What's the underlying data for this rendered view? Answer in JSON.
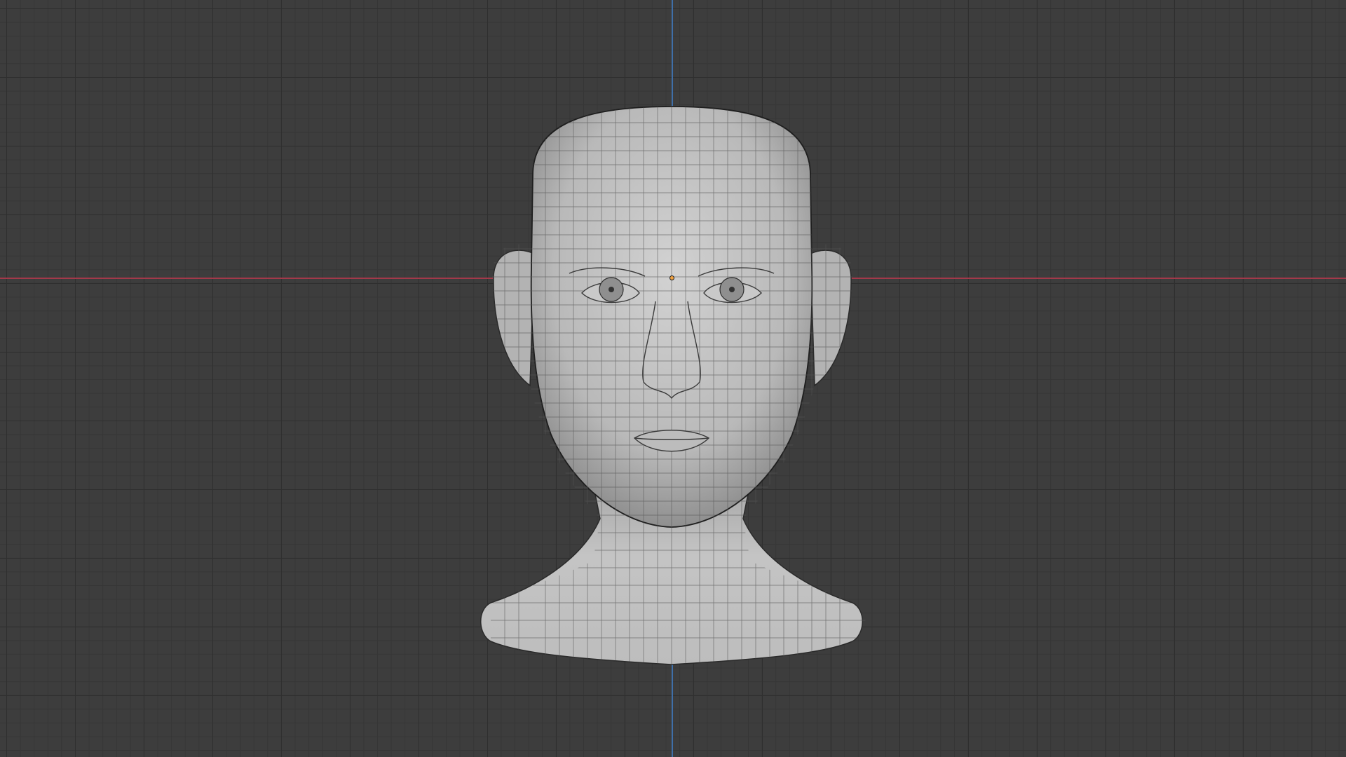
{
  "viewport": {
    "grid_color": "#2f2f2f",
    "background_color": "#3d3d3d",
    "x_axis_color": "#a3394a",
    "z_axis_color": "#3f6fa8",
    "object": "human-head-mesh",
    "wireframe_overlay": true,
    "origin_color": "#f0a040"
  }
}
